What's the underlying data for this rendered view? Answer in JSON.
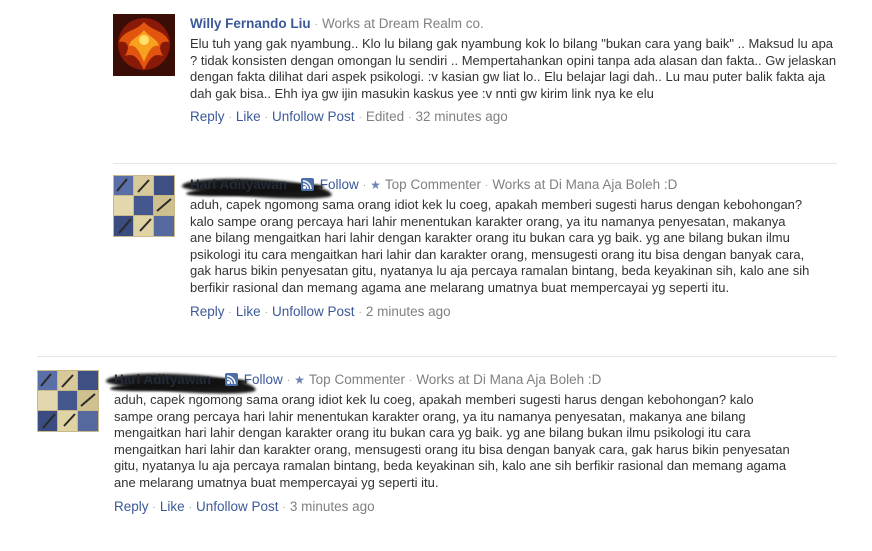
{
  "colors": {
    "link": "#3b5998",
    "meta": "#808080",
    "text": "#333333"
  },
  "comments": [
    {
      "avatar": "phoenix-avatar",
      "author": "Willy Fernando Liu",
      "work": "Works at Dream Realm co.",
      "text": "Elu tuh yang gak nyambung.. Klo lu bilang gak nyambung kok lo bilang \"bukan cara yang baik\" .. Maksud lu apa ? tidak konsisten dengan omongan lu sendiri .. Mempertahankan opini tanpa ada alasan dan fakta.. Gw jelaskan dengan fakta dilihat dari aspek psikologi. :v kasian gw liat lo.. Elu belajar lagi dah.. Lu mau puter balik fakta aja dah gak bisa.. Ehh iya gw ijin masukin kaskus yee :v nnti gw kirim link nya ke elu",
      "reply": "Reply",
      "like": "Like",
      "unfollow": "Unfollow Post",
      "edited": "Edited",
      "time": "32 minutes ago"
    },
    {
      "avatar": "collage-avatar",
      "author": "Hari Adityawan",
      "follow": "Follow",
      "badge": "Top Commenter",
      "work": "Works at Di Mana Aja Boleh :D",
      "text": "aduh, capek ngomong sama orang idiot kek lu coeg, apakah memberi sugesti harus dengan kebohongan? kalo sampe orang percaya hari lahir menentukan karakter orang, ya itu namanya penyesatan, makanya ane bilang mengaitkan hari lahir dengan karakter orang itu bukan cara yg baik. yg ane bilang bukan ilmu psikologi itu cara mengaitkan hari lahir dan karakter orang, mensugesti orang itu bisa dengan banyak cara, gak harus bikin penyesatan gitu, nyatanya lu aja percaya ramalan bintang, beda keyakinan sih, kalo ane sih berfikir rasional dan memang agama ane melarang umatnya buat mempercayai yg seperti itu.",
      "reply": "Reply",
      "like": "Like",
      "unfollow": "Unfollow Post",
      "time": "2 minutes ago"
    },
    {
      "avatar": "collage-avatar",
      "author": "Hari Adityawan",
      "follow": "Follow",
      "badge": "Top Commenter",
      "work": "Works at Di Mana Aja Boleh :D",
      "text": "aduh, capek ngomong sama orang idiot kek lu coeg, apakah memberi sugesti harus dengan kebohongan? kalo sampe orang percaya hari lahir menentukan karakter orang, ya itu namanya penyesatan, makanya ane bilang mengaitkan hari lahir dengan karakter orang itu bukan cara yg baik. yg ane bilang bukan ilmu psikologi itu cara mengaitkan hari lahir dan karakter orang, mensugesti orang itu bisa dengan banyak cara, gak harus bikin penyesatan gitu, nyatanya lu aja percaya ramalan bintang, beda keyakinan sih, kalo ane sih berfikir rasional dan memang agama ane melarang umatnya buat mempercayai yg seperti itu.",
      "reply": "Reply",
      "like": "Like",
      "unfollow": "Unfollow Post",
      "time": "3 minutes ago"
    }
  ]
}
